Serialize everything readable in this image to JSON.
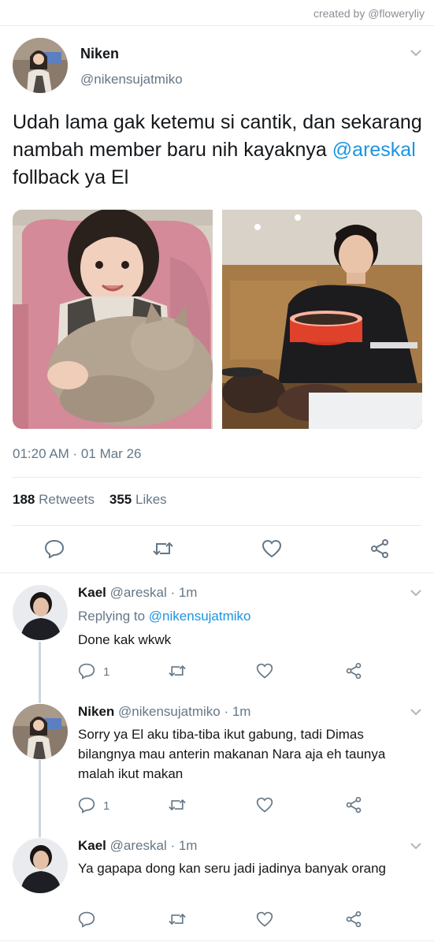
{
  "credit": "created by @floweryliy",
  "main_tweet": {
    "name": "Niken",
    "handle": "@nikensujatmiko",
    "text_before": "Udah lama gak ketemu si cantik, dan sekarang nambah member baru nih kayaknya ",
    "mention": "@areskal",
    "text_after": " follback ya El",
    "timestamp": "01:20 AM · 01 Mar 26",
    "retweets_count": "188",
    "retweets_label": "Retweets",
    "likes_count": "355",
    "likes_label": "Likes"
  },
  "replies": [
    {
      "name": "Kael",
      "handle": "@areskal",
      "time": "· 1m",
      "replying_label": "Replying to",
      "replying_to": "@nikensujatmiko",
      "text": "Done kak wkwk",
      "reply_count": "1"
    },
    {
      "name": "Niken",
      "handle": "@nikensujatmiko",
      "time": "· 1m",
      "text": "Sorry ya El aku tiba-tiba ikut gabung, tadi Dimas bilangnya mau anterin makanan Nara aja eh taunya malah ikut makan",
      "reply_count": "1"
    },
    {
      "name": "Kael",
      "handle": "@areskal",
      "time": "· 1m",
      "text": "Ya gapapa dong kan seru jadi jadinya banyak orang",
      "reply_count": ""
    }
  ],
  "icons": {
    "reply": "reply-icon",
    "retweet": "retweet-icon",
    "like": "heart-icon",
    "share": "share-icon",
    "menu": "chevron-down-icon"
  },
  "colors": {
    "accent": "#1b95e0",
    "text": "#14171a",
    "muted": "#657786",
    "divider": "#e6ecf0"
  }
}
